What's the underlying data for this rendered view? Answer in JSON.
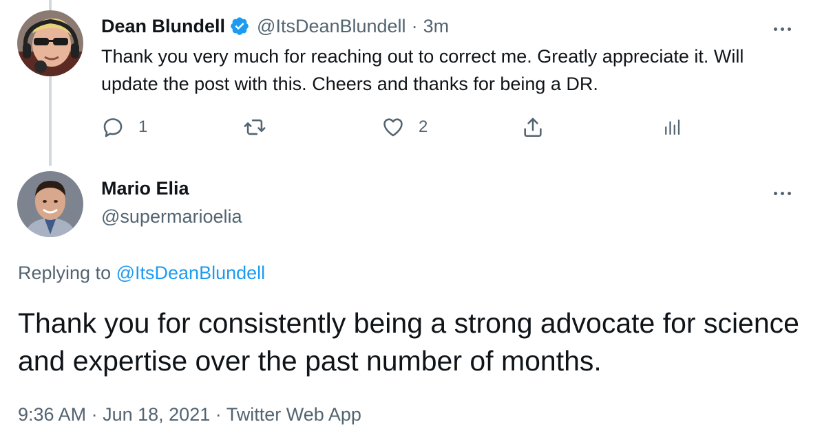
{
  "thread_tweet": {
    "display_name": "Dean Blundell",
    "verified": true,
    "handle": "@ItsDeanBlundell",
    "separator": "·",
    "time_ago": "3m",
    "text": "Thank you very much for reaching out to correct me.  Greatly appreciate it.  Will update the post with this.  Cheers and thanks for being a DR.",
    "actions": {
      "reply_count": "1",
      "retweet_count": "",
      "like_count": "2"
    }
  },
  "main_tweet": {
    "display_name": "Mario Elia",
    "handle": "@supermarioelia",
    "replying_prefix": "Replying to",
    "replying_to": "@ItsDeanBlundell",
    "text": "Thank you for consistently being a strong advocate for science and expertise over the past number of months.",
    "time": "9:36 AM",
    "separator": "·",
    "date": "Jun 18, 2021",
    "source": "Twitter Web App"
  },
  "colors": {
    "accent": "#1d9bf0",
    "text_primary": "#0f1419",
    "text_secondary": "#536471",
    "thread_line": "#cfd9de"
  },
  "icons": {
    "verified": "verified-badge-icon",
    "more": "more-options-icon",
    "reply": "reply-icon",
    "retweet": "retweet-icon",
    "like": "heart-icon",
    "share": "share-icon",
    "analytics": "analytics-icon"
  }
}
